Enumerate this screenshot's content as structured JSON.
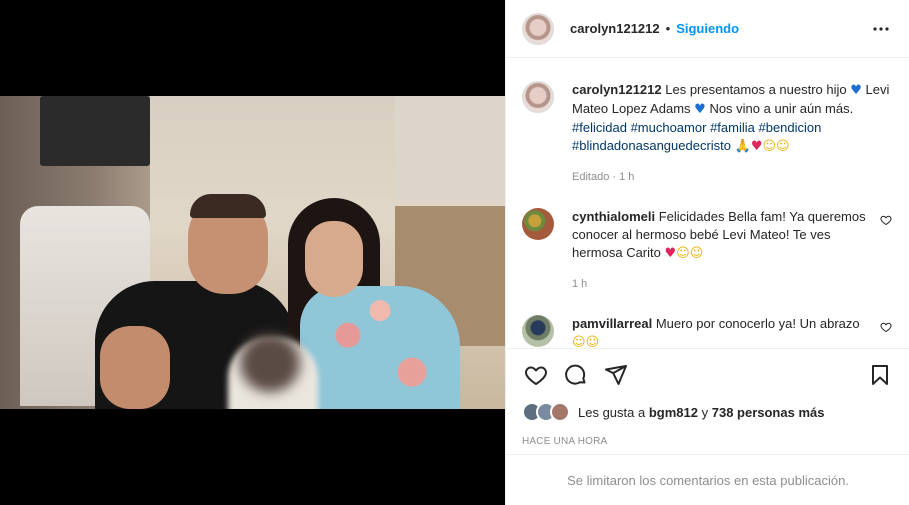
{
  "post": {
    "username": "carolyn121212",
    "follow_status": "Siguiendo",
    "separator": "•",
    "more_glyph": "•••"
  },
  "caption": {
    "username": "carolyn121212",
    "text_1": "Les presentamos a nuestro hijo",
    "text_2": "Levi Mateo Lopez Adams",
    "text_3": "Nos vino a unir aún más.",
    "hashtags": [
      "#felicidad",
      "#muchoamor",
      "#familia",
      "#bendicion",
      "#blindadonasanguedecristo"
    ],
    "edited": "Editado · 1 h"
  },
  "comments": [
    {
      "username": "cynthialomeli",
      "text": "Felicidades Bella fam! Ya queremos conocer al hermoso bebé Levi Mateo! Te ves hermosa Carito",
      "time": "1 h"
    },
    {
      "username": "pamvillarreal",
      "text": "Muero por conocerlo ya! Un abrazo"
    }
  ],
  "likes": {
    "prefix": "Les gusta a",
    "user": "bgm812",
    "middle": "y",
    "count_text": "738 personas más"
  },
  "timestamp": "HACE UNA HORA",
  "comments_limited": "Se limitaron los comentarios en esta publicación.",
  "colors": {
    "accent": "#0095f6",
    "text": "#262626",
    "muted": "#8e8e8e",
    "hashtag": "#00376b"
  },
  "icons": [
    "heart-icon",
    "comment-icon",
    "share-icon",
    "bookmark-icon",
    "more-icon"
  ]
}
